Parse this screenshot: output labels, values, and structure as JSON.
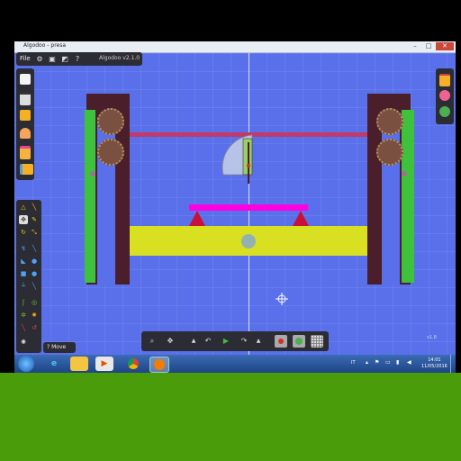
{
  "window": {
    "title": "Algodoo - presa",
    "controls": {
      "minimize": "–",
      "maximize": "□",
      "close": "✕"
    }
  },
  "top_menu": {
    "file_label": "File",
    "icons": [
      "settings-icon",
      "save-icon",
      "screenshot-icon",
      "help-icon"
    ],
    "help_label": "?",
    "version": "Algodoo v2.1.0"
  },
  "left_sidebar": {
    "items": [
      "new-scene-icon",
      "print-icon",
      "open-folder-icon",
      "cake-icon",
      "scenes-icon",
      "save-scene-icon"
    ]
  },
  "tools": {
    "move_tooltip_key": "?",
    "move_tooltip_label": "Move"
  },
  "bottom_toolbar": {
    "items": [
      "zoom-icon",
      "pan-icon",
      "undo-icon",
      "play-icon",
      "redo-icon",
      "gravity-icon",
      "air-icon",
      "grid-icon"
    ]
  },
  "taskbar": {
    "lang": "IT",
    "time": "14:01",
    "date": "11/05/2016"
  },
  "watermark": "v1.8"
}
